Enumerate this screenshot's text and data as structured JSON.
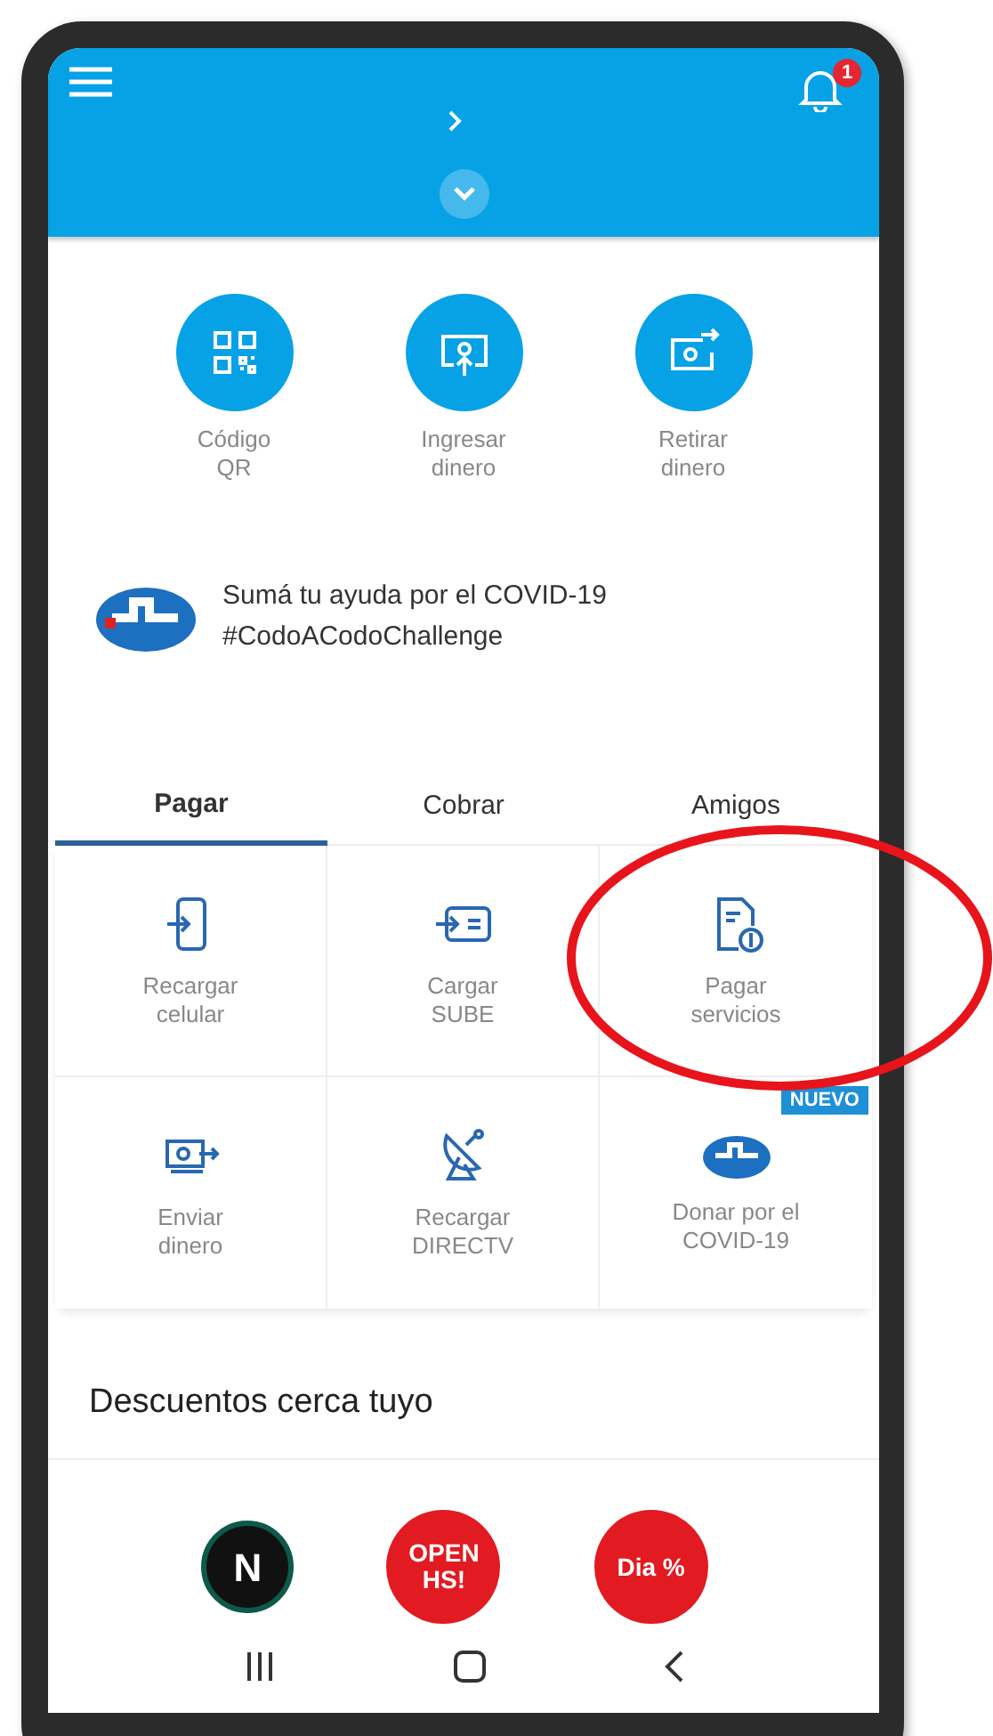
{
  "header": {
    "notification_count": "1"
  },
  "quick_actions": [
    {
      "kind": "qr",
      "lines": [
        "Código",
        "QR"
      ]
    },
    {
      "kind": "deposit",
      "lines": [
        "Ingresar",
        "dinero"
      ]
    },
    {
      "kind": "withdraw",
      "lines": [
        "Retirar",
        "dinero"
      ]
    }
  ],
  "promo": {
    "lines": [
      "Sumá tu ayuda por el COVID-19",
      "#CodoACodoChallenge"
    ]
  },
  "tabs": [
    {
      "label": "Pagar",
      "selected": true
    },
    {
      "label": "Cobrar",
      "selected": false
    },
    {
      "label": "Amigos",
      "selected": false
    }
  ],
  "services": [
    {
      "kind": "phone",
      "lines": [
        "Recargar",
        "celular"
      ]
    },
    {
      "kind": "card",
      "lines": [
        "Cargar",
        "SUBE"
      ]
    },
    {
      "kind": "bill",
      "lines": [
        "Pagar",
        "servicios"
      ],
      "highlighted": true
    },
    {
      "kind": "send",
      "lines": [
        "Enviar",
        "dinero"
      ]
    },
    {
      "kind": "satellite",
      "lines": [
        "Recargar",
        "DIRECTV"
      ]
    },
    {
      "kind": "charity",
      "lines": [
        "Donar por el",
        "COVID-19"
      ],
      "badge": "NUEVO"
    }
  ],
  "discounts": {
    "title": "Descuentos cerca tuyo",
    "logos": [
      {
        "kind": "dark",
        "text": "N"
      },
      {
        "kind": "red",
        "text": "OPEN HS!"
      },
      {
        "kind": "red",
        "text": "Dia %"
      }
    ]
  }
}
